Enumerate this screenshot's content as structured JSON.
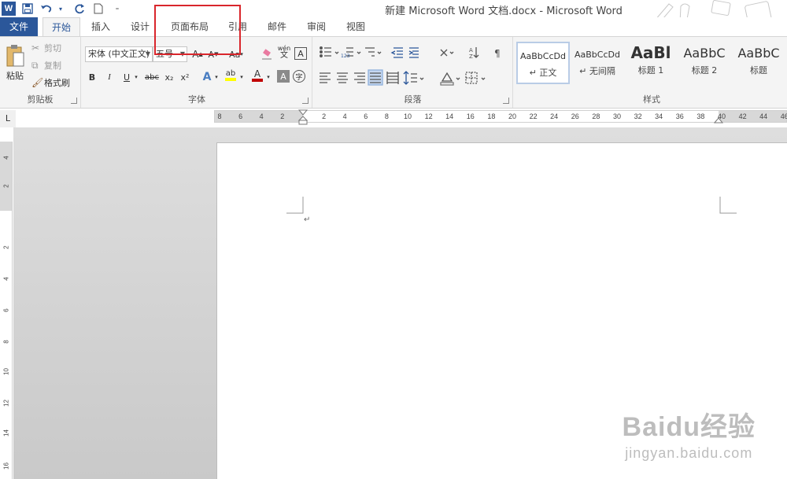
{
  "window": {
    "title": "新建 Microsoft Word 文档.docx - Microsoft Word"
  },
  "qat": {
    "logo": "W",
    "icons": [
      "save-icon",
      "undo-icon",
      "redo-icon",
      "new-document-icon",
      "customize-icon"
    ]
  },
  "tabs": [
    {
      "label": "文件",
      "state": "file"
    },
    {
      "label": "开始",
      "state": "active"
    },
    {
      "label": "插入",
      "state": ""
    },
    {
      "label": "设计",
      "state": ""
    },
    {
      "label": "页面布局",
      "state": ""
    },
    {
      "label": "引用",
      "state": ""
    },
    {
      "label": "邮件",
      "state": ""
    },
    {
      "label": "审阅",
      "state": ""
    },
    {
      "label": "视图",
      "state": ""
    }
  ],
  "clipboard": {
    "paste": "粘贴",
    "cut": "剪切",
    "copy": "复制",
    "format_painter": "格式刷",
    "label": "剪贴板"
  },
  "font": {
    "font_name": "宋体 (中文正文)",
    "font_size": "五号",
    "grow": "A",
    "shrink": "A",
    "case": "Aa",
    "bold": "B",
    "italic": "I",
    "underline": "U",
    "strike": "abc",
    "subscript": "x₂",
    "superscript": "x²",
    "effects": "A",
    "highlight": "ab",
    "font_color": "A",
    "shading": "A",
    "phonetic": "wén",
    "phonetic_sub": "文",
    "enclose": "字",
    "border_char": "A",
    "label": "字体"
  },
  "paragraph": {
    "label": "段落"
  },
  "styles": {
    "label": "样式",
    "items": [
      {
        "sample": "AaBbCcDd",
        "name": "↵ 正文",
        "selected": true
      },
      {
        "sample": "AaBbCcDd",
        "name": "↵ 无间隔",
        "selected": false
      },
      {
        "sample": "AaBl",
        "name": "标题 1",
        "selected": false
      },
      {
        "sample": "AaBbC",
        "name": "标题 2",
        "selected": false
      },
      {
        "sample": "AaBbC",
        "name": "标题",
        "selected": false
      }
    ]
  },
  "ruler": {
    "corner": "L",
    "left_numbers": [
      "8",
      "6",
      "4",
      "2"
    ],
    "right_numbers": [
      "2",
      "4",
      "6",
      "8",
      "10",
      "12",
      "14",
      "16",
      "18",
      "20",
      "22",
      "24",
      "26",
      "28",
      "30",
      "32",
      "34",
      "36",
      "38",
      "40",
      "42",
      "44",
      "46"
    ],
    "vertical_numbers": [
      "4",
      "2",
      "2",
      "4",
      "6",
      "8",
      "10",
      "12",
      "14",
      "16"
    ]
  },
  "document": {
    "paragraph_mark": "↵"
  },
  "watermark": {
    "main": "Baidu经验",
    "sub": "jingyan.baidu.com"
  },
  "colors": {
    "accent": "#2b579a",
    "highlight_box": "#d9262c",
    "font_color_bar": "#c00000",
    "highlight_bar": "#ffff00"
  }
}
